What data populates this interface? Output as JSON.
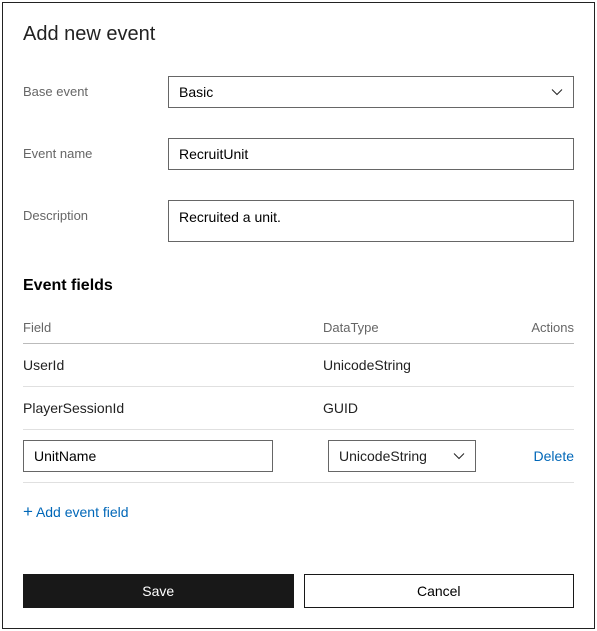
{
  "title": "Add new event",
  "form": {
    "base_event_label": "Base event",
    "base_event_value": "Basic",
    "event_name_label": "Event name",
    "event_name_value": "RecruitUnit",
    "description_label": "Description",
    "description_value": "Recruited a unit."
  },
  "fields_section": {
    "title": "Event fields",
    "headers": {
      "field": "Field",
      "datatype": "DataType",
      "actions": "Actions"
    },
    "rows": [
      {
        "field": "UserId",
        "datatype": "UnicodeString"
      },
      {
        "field": "PlayerSessionId",
        "datatype": "GUID"
      }
    ],
    "edit_row": {
      "field": "UnitName",
      "datatype": "UnicodeString",
      "action": "Delete"
    },
    "add_link": "Add event field"
  },
  "buttons": {
    "save": "Save",
    "cancel": "Cancel"
  }
}
